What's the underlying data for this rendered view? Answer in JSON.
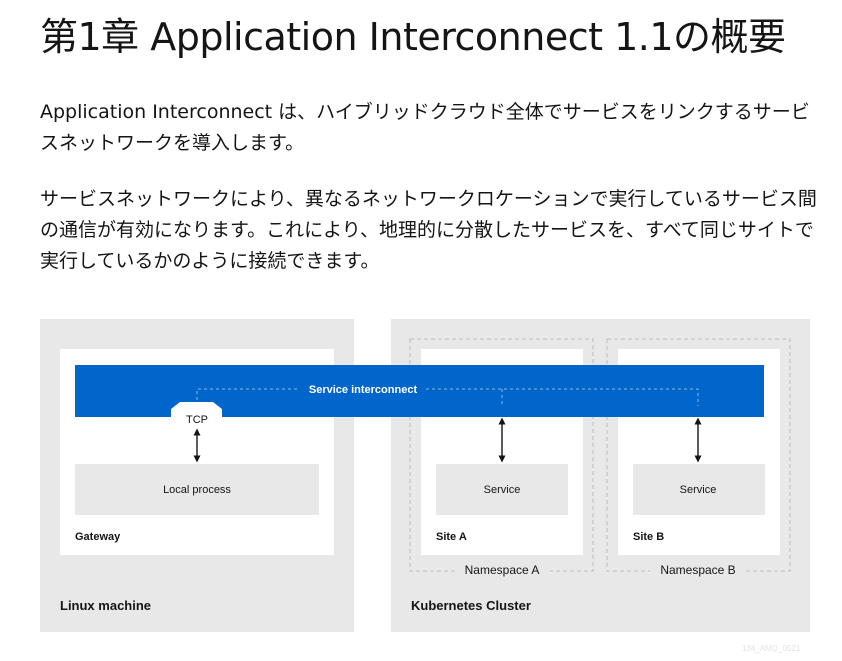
{
  "page": {
    "title": "第1章 Application Interconnect 1.1の概要",
    "paragraphs": [
      "Application Interconnect は、ハイブリッドクラウド全体でサービスをリンクするサービスネットワークを導入します。",
      "サービスネットワークにより、異なるネットワークロケーションで実行しているサービス間の通信が有効になります。これにより、地理的に分散したサービスを、すべて同じサイトで実行しているかのように接続できます。"
    ]
  },
  "diagram": {
    "interconnect_label": "Service interconnect",
    "tcp_label": "TCP",
    "local_process_label": "Local process",
    "gateway_label": "Gateway",
    "linux_machine_label": "Linux machine",
    "kubernetes_label": "Kubernetes Cluster",
    "site_a": {
      "service_label": "Service",
      "site_label": "Site A",
      "namespace_label": "Namespace A"
    },
    "site_b": {
      "service_label": "Service",
      "site_label": "Site B",
      "namespace_label": "Namespace B"
    },
    "watermark": "134_AMQ_0521",
    "colors": {
      "interconnect": "#0066cc",
      "panel": "#e8e8e8",
      "box": "#ffffff",
      "inner": "#e8e8e8"
    }
  }
}
